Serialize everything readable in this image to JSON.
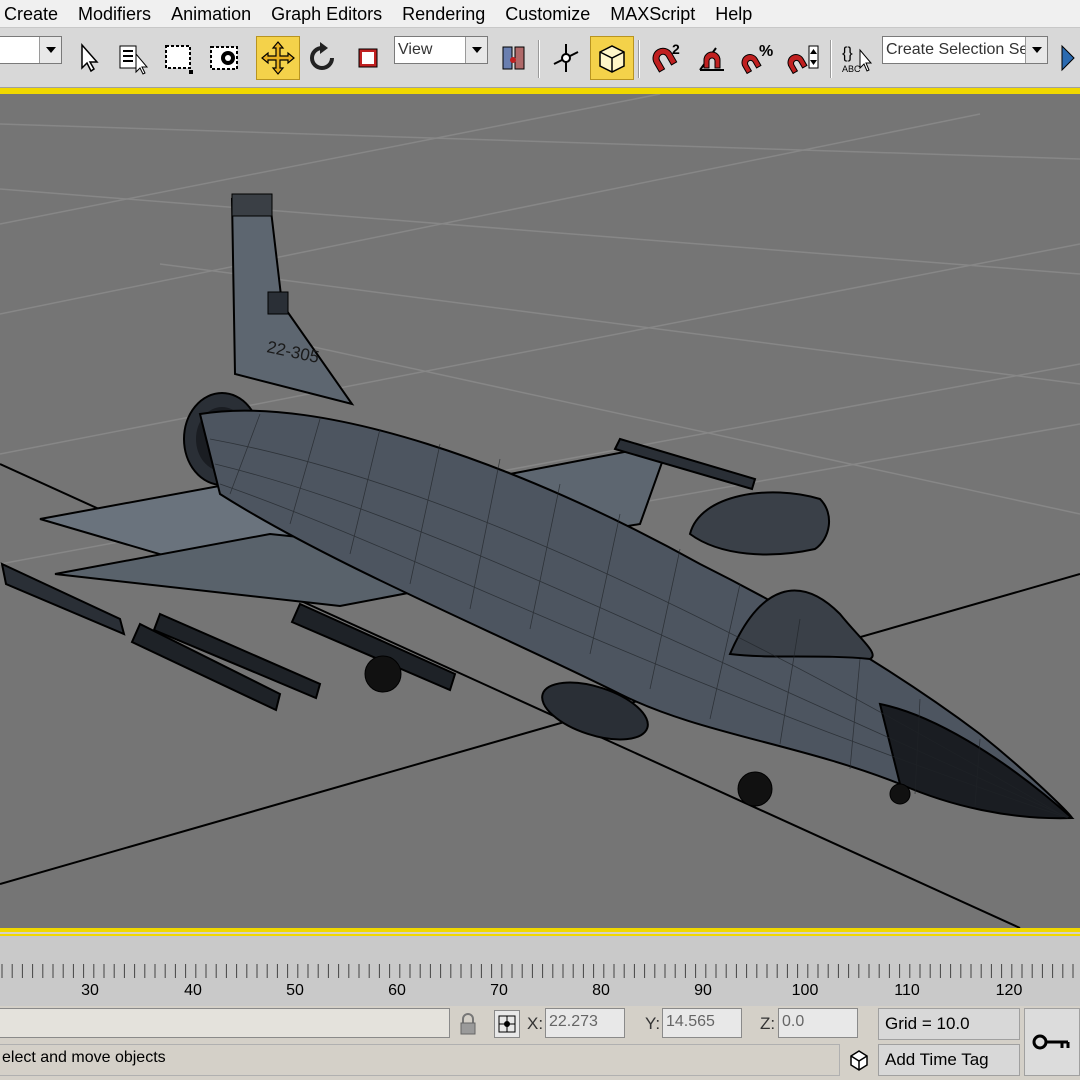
{
  "menu": [
    "Create",
    "Modifiers",
    "Animation",
    "Graph Editors",
    "Rendering",
    "Customize",
    "MAXScript",
    "Help"
  ],
  "toolbar": {
    "reference_dropdown": "View",
    "selection_set_dropdown": "Create Selection Set"
  },
  "icons": {
    "select": "select-object-icon",
    "select_by_name": "select-by-name-icon",
    "rect_region": "rectangular-selection-region-icon",
    "window_crossing": "window-crossing-icon",
    "move": "select-and-move-icon",
    "rotate": "select-and-rotate-icon",
    "scale": "select-and-scale-icon",
    "pivot": "use-pivot-center-icon",
    "manipulate": "select-and-manipulate-icon",
    "keyboard_shortcut": "keyboard-shortcut-override-icon",
    "snap_2d": "snaps-toggle-icon",
    "angle_snap": "angle-snap-icon",
    "percent_snap": "percent-snap-icon",
    "spinner_snap": "spinner-snap-icon",
    "named_selection": "edit-named-selection-icon",
    "lock": "lock-selection-icon",
    "absolute_mode": "absolute-mode-icon",
    "key": "set-key-icon",
    "time_tag": "time-tag-icon"
  },
  "viewport": {
    "tail_number": "22-305",
    "background_color": "#757575",
    "active_border_color": "#f0d800"
  },
  "timeline": {
    "ticks": [
      "30",
      "40",
      "50",
      "60",
      "70",
      "80",
      "90",
      "100",
      "110",
      "120"
    ]
  },
  "status": {
    "x_label": "X:",
    "x_value": "22.273",
    "y_label": "Y:",
    "y_value": "14.565",
    "z_label": "Z:",
    "z_value": "0.0",
    "grid": "Grid = 10.0",
    "prompt": "elect and move objects",
    "add_time_tag": "Add Time Tag"
  }
}
